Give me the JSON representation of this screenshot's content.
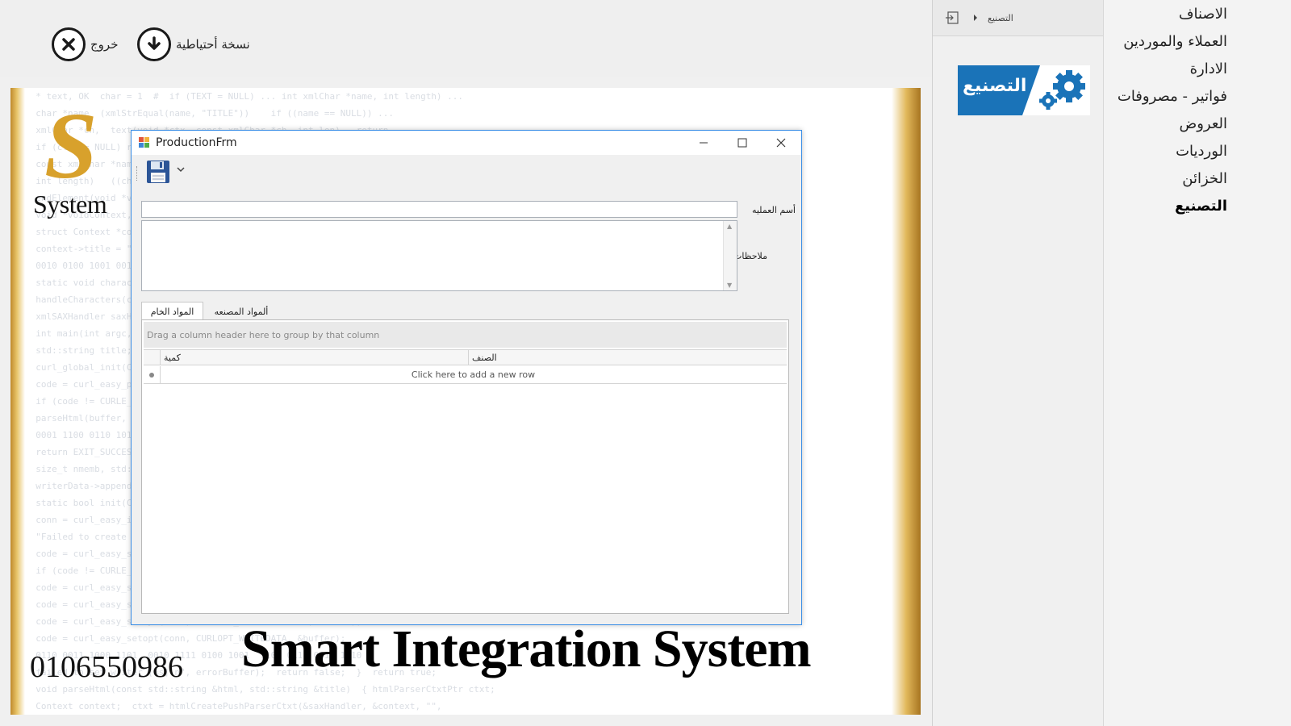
{
  "toolbar": {
    "exit_label": "خروج",
    "backup_label": "نسخة أحتياطية"
  },
  "background": {
    "logo_letter": "S",
    "logo_word": "System",
    "phone": "0106550986",
    "brand": "Smart Integration System",
    "code_lines": [
      "  * text, OK  char = 1  #  if (TEXT = NULL) ... int xmlChar *name, int length) ...",
      "  char *name  (xmlStrEqual(name, \"TITLE\"))    if ((name == NULL)) ...",
      "  xmlChar *ch,  text(void *ctx, const xmlChar *ch, int len)   return  ...",
      "  if (ctx == NULL) return;   callback function  (void *voidContext,",
      "  const xmlChar *name)  characters(Context *context, const xmlChar *chars,",
      "  int length)   ((char *)chars, length)  startElement(void *voidContext,",
      "  endElement(void *voidContext, const xmlChar *name)   context->addTitle = false;",
      "  void *voidContext, const xmlChar *chars, int length)  ...",
      "  struct Context *context = (Context *)voidContext;  if (COMPARE(name, \"TITLE\"))",
      "  context->title = \"\";  context->addTitle = true;  }  return;",
      "  0010 0100 1001 0010  1111 0000 1010  0011 1100 0101 1110 0010 0111",
      "  static void charactersHandler(void *ctx, const xmlChar *ch, int len)",
      "  handleCharacters(context, chars, length);  }  failed to set write data [%s]",
      "  xmlSAXHandler saxHandler = { NULL, NULL, NULL, NULL, NULL, NULL, NULL };",
      "  int main(int argc, char *argv[])  {  CURL *conn = NULL;  CURLcode code;",
      "  std::string title;  if (argc != 2) { fprintf(stderr, \"Usage: %s <url>\\n\",",
      "  curl_global_init(CURL_GLOBAL_DEFAULT);  if (!init(conn, argv[1]))",
      "  code = curl_easy_perform(conn);  curl_easy_cleanup(conn);",
      "  if (code != CURLE_OK) { fprintf(stderr, \"Failed to get '%s' [%s]\\n\",",
      "  parseHtml(buffer, title);  printf(\"Title: %s\\n\", title.c_str());",
      "  0001 1100 0110 1011  0100 1110 0001 0111  1001 0010 1101 0011",
      "  return EXIT_SUCCESS;  }  static int writer(char *data, size_t size,",
      "  size_t nmemb, std::string *writerData)  { if (writerData == NULL) return 0;",
      "  writerData->append(data, size*nmemb);  return size * nmemb;  }",
      "  static bool init(CURL *&conn, char *url)  { CURLcode code;",
      "  conn = curl_easy_init();  if (conn == NULL) { fprintf(stderr,",
      "  \"Failed to create CURL connection\\n\");  exit(EXIT_FAILURE);  }",
      "  code = curl_easy_setopt(conn, CURLOPT_ERRORBUFFER, errorBuffer);",
      "  if (code != CURLE_OK) { fprintf(stderr, \"Failed to set error buffer [%d]\\n\",",
      "  code = curl_easy_setopt(conn, CURLOPT_URL, url);  if (code != CURLE_OK)",
      "  code = curl_easy_setopt(conn, CURLOPT_FOLLOWLOCATION, 1L);",
      "  code = curl_easy_setopt(conn, CURLOPT_WRITEFUNCTION, writer);",
      "  code = curl_easy_setopt(conn, CURLOPT_WRITEDATA, &buffer);",
      "  0110 0011 1000 1101  0010 1111 0100 1001  1100 0111 0010 1010",
      "  failed to set writer [%s]\\n\", errorBuffer);  return false;  }  return true;",
      "  void parseHtml(const std::string &html, std::string &title)  { htmlParserCtxtPtr ctxt;",
      "  Context context;  ctxt = htmlCreatePushParserCtxt(&saxHandler, &context, \"\",",
      "  htmlParseChunk(ctxt, html.c_str(), html.size(), 0);  htmlParseChunk(ctxt, \"\", 0, 1);"
    ]
  },
  "dialog": {
    "title": "ProductionFrm",
    "operation_name_label": "أسم العمليه",
    "operation_name_value": "",
    "notes_label": "ملاحظات",
    "notes_value": "",
    "tabs": [
      {
        "label": "المواد الخام",
        "active": true
      },
      {
        "label": "ألمواد المصنعه",
        "active": false
      }
    ],
    "grid": {
      "group_hint": "Drag a column header here to group by that column",
      "columns": [
        "كمية",
        "الصنف"
      ],
      "new_row_text": "Click here to add a new row"
    }
  },
  "nav": {
    "breadcrumb": "التصنيع",
    "module_tile": "التصنيع"
  },
  "menu": {
    "items": [
      {
        "label": "الاصناف",
        "selected": false
      },
      {
        "label": "العملاء والموردين",
        "selected": false
      },
      {
        "label": "الادارة",
        "selected": false
      },
      {
        "label": "فواتير - مصروفات",
        "selected": false
      },
      {
        "label": "العروض",
        "selected": false
      },
      {
        "label": "الورديات",
        "selected": false
      },
      {
        "label": "الخزائن",
        "selected": false
      },
      {
        "label": "التصنيع",
        "selected": true
      }
    ]
  },
  "colors": {
    "accent": "#1a73b8",
    "window_border": "#3a8ee6",
    "gold": "#d8a12c"
  }
}
